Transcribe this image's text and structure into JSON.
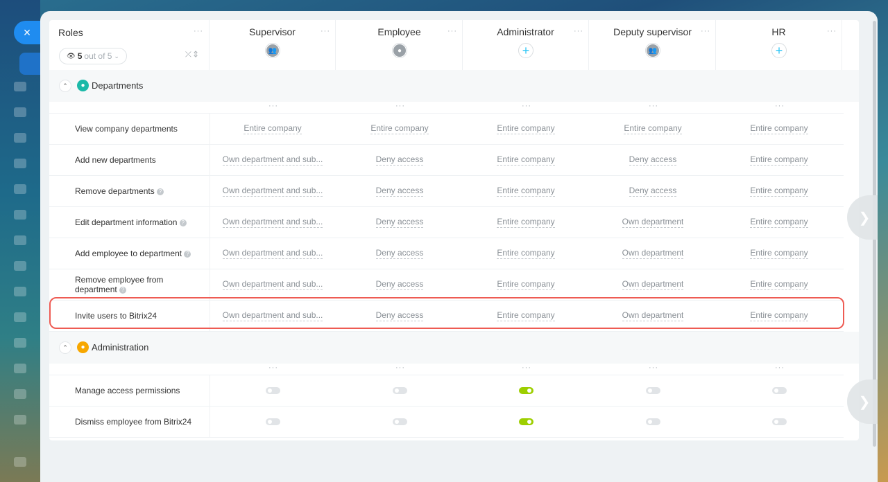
{
  "close_icon": "×",
  "header": {
    "roles_label": "Roles",
    "count_num": "5",
    "count_text": "out of 5",
    "more_icon": "···"
  },
  "roles": [
    {
      "name": "Supervisor",
      "icon": "group"
    },
    {
      "name": "Employee",
      "icon": "user"
    },
    {
      "name": "Administrator",
      "icon": "plus"
    },
    {
      "name": "Deputy supervisor",
      "icon": "group"
    },
    {
      "name": "HR",
      "icon": "plus"
    }
  ],
  "sections": [
    {
      "title": "Departments",
      "icon_color": "#1bb9a8",
      "rows": [
        {
          "label": "View company departments",
          "help": false,
          "values": [
            "Entire company",
            "Entire company",
            "Entire company",
            "Entire company",
            "Entire company"
          ]
        },
        {
          "label": "Add new departments",
          "help": false,
          "values": [
            "Own department and sub...",
            "Deny access",
            "Entire company",
            "Deny access",
            "Entire company"
          ]
        },
        {
          "label": "Remove departments",
          "help": true,
          "values": [
            "Own department and sub...",
            "Deny access",
            "Entire company",
            "Deny access",
            "Entire company"
          ]
        },
        {
          "label": "Edit department information",
          "help": true,
          "values": [
            "Own department and sub...",
            "Deny access",
            "Entire company",
            "Own department",
            "Entire company"
          ]
        },
        {
          "label": "Add employee to department",
          "help": true,
          "values": [
            "Own department and sub...",
            "Deny access",
            "Entire company",
            "Own department",
            "Entire company"
          ]
        },
        {
          "label": "Remove employee from department",
          "help": true,
          "values": [
            "Own department and sub...",
            "Deny access",
            "Entire company",
            "Own department",
            "Entire company"
          ]
        },
        {
          "label": "Invite users to Bitrix24",
          "help": false,
          "values": [
            "Own department and sub...",
            "Deny access",
            "Entire company",
            "Own department",
            "Entire company"
          ]
        }
      ]
    },
    {
      "title": "Administration",
      "icon_color": "#f7a700",
      "rows": [
        {
          "label": "Manage access permissions",
          "help": false,
          "toggles": [
            false,
            false,
            true,
            false,
            false
          ]
        },
        {
          "label": "Dismiss employee from Bitrix24",
          "help": false,
          "toggles": [
            false,
            false,
            true,
            false,
            false
          ]
        }
      ]
    }
  ],
  "colors": {
    "accent": "#1f8cf0",
    "toggle_on": "#9dcf00",
    "highlight": "#ee5b53"
  }
}
